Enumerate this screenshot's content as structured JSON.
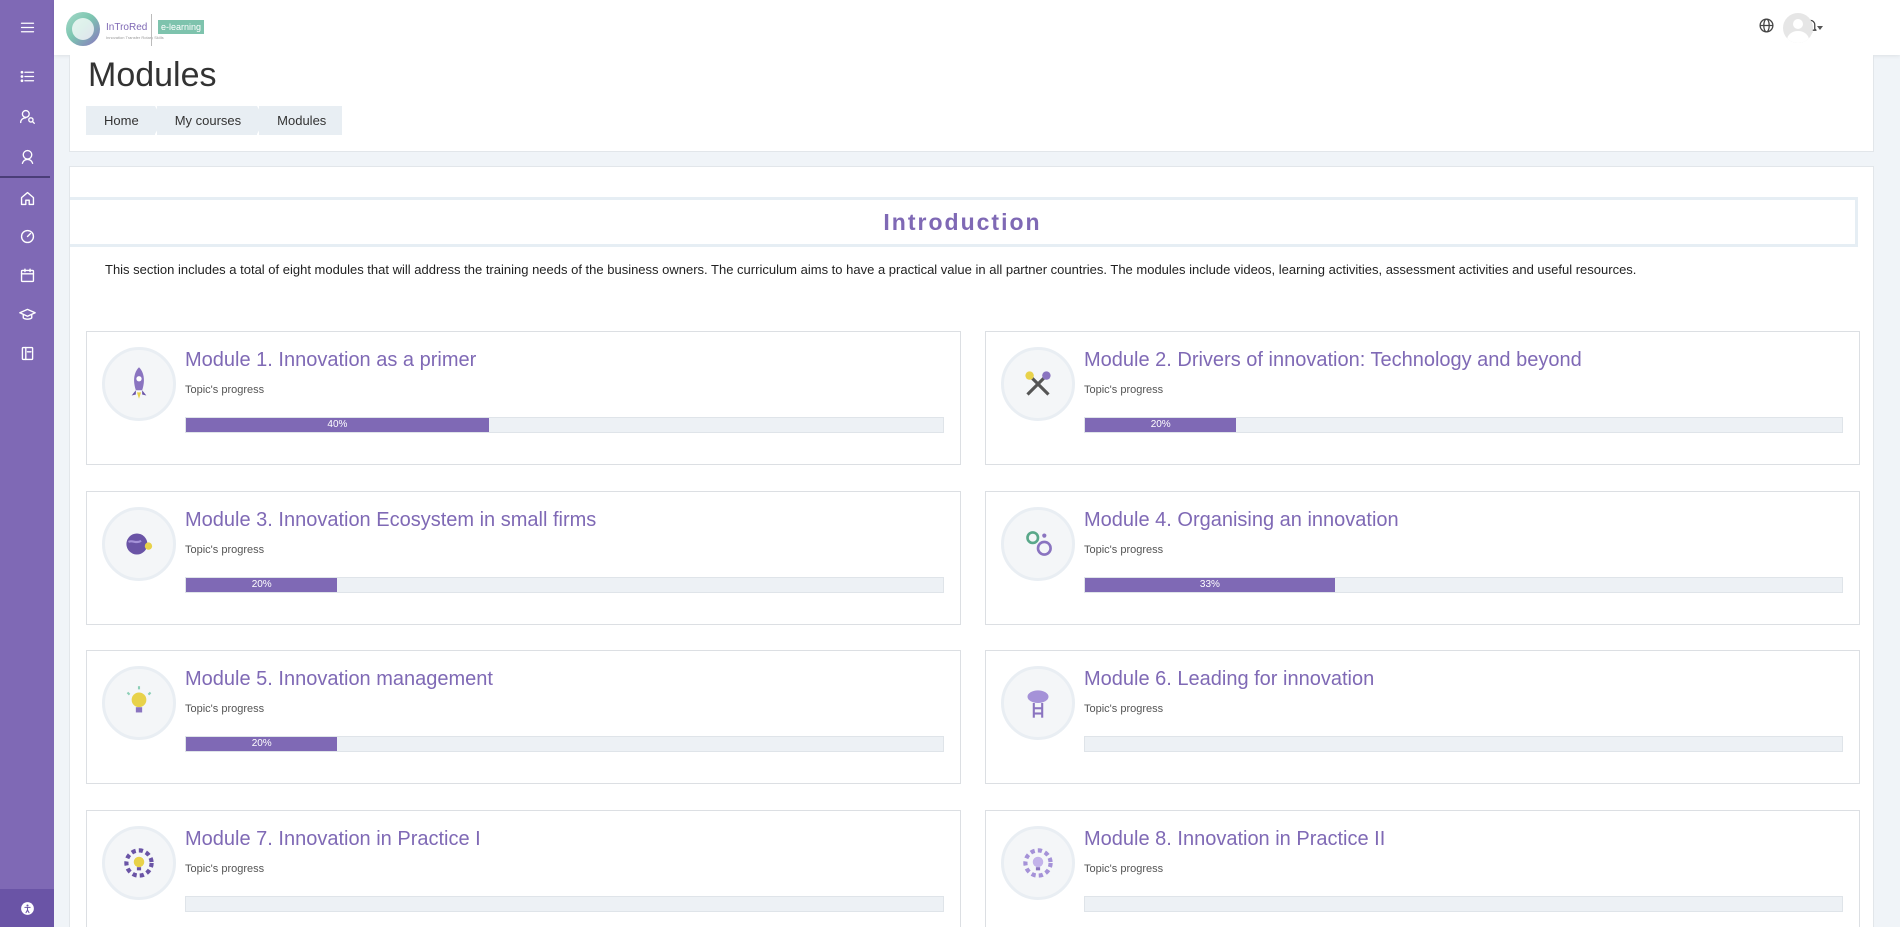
{
  "sidebar": {
    "items": [
      {
        "icon": "menu-icon"
      },
      {
        "icon": "list-icon"
      },
      {
        "icon": "user-search-icon"
      },
      {
        "icon": "user-badge-icon"
      },
      {
        "icon": "home-icon"
      },
      {
        "icon": "dashboard-icon"
      },
      {
        "icon": "calendar-icon"
      },
      {
        "icon": "graduation-cap-icon"
      },
      {
        "icon": "book-icon"
      }
    ],
    "bottom_icon": "accessibility-icon"
  },
  "topbar": {
    "logo_text": "InTroRed",
    "logo_sub": "Innovation Transfer Rotary Skills",
    "logo_badge": "e-learning",
    "icons": [
      "globe-icon",
      "bell-icon",
      "avatar-icon"
    ]
  },
  "header": {
    "title": "Modules",
    "breadcrumb": [
      "Home",
      "My courses",
      "Modules"
    ]
  },
  "intro": {
    "title": "Introduction",
    "text": "This section includes a total of eight modules that will address the training needs of the business owners. The curriculum aims to have a practical value in all partner countries. The modules include videos, learning activities, assessment activities and useful resources."
  },
  "modules": [
    {
      "title": "Module 1. Innovation as a primer",
      "subtitle": "Topic's progress",
      "progress": 40,
      "progress_label": "40%",
      "icon": "rocket-icon"
    },
    {
      "title": "Module 2. Drivers of innovation: Technology and beyond",
      "subtitle": "Topic's progress",
      "progress": 20,
      "progress_label": "20%",
      "icon": "tools-icon"
    },
    {
      "title": "Module 3. Innovation Ecosystem in small firms",
      "subtitle": "Topic's progress",
      "progress": 20,
      "progress_label": "20%",
      "icon": "globe-leaf-icon"
    },
    {
      "title": "Module 4. Organising an innovation",
      "subtitle": "Topic's progress",
      "progress": 33,
      "progress_label": "33%",
      "icon": "gears-icon"
    },
    {
      "title": "Module 5. Innovation management",
      "subtitle": "Topic's progress",
      "progress": 20,
      "progress_label": "20%",
      "icon": "lightbulb-icon"
    },
    {
      "title": "Module 6. Leading for innovation",
      "subtitle": "Topic's progress",
      "progress": 0,
      "progress_label": "",
      "icon": "cloud-ladder-icon"
    },
    {
      "title": "Module 7. Innovation in Practice I",
      "subtitle": "Topic's progress",
      "progress": 0,
      "progress_label": "",
      "icon": "gear-bulb-icon"
    },
    {
      "title": "Module 8. Innovation in Practice II",
      "subtitle": "Topic's progress",
      "progress": 0,
      "progress_label": "",
      "icon": "gear-bulb-purple-icon"
    }
  ],
  "colors": {
    "sidebar": "#7f69b5",
    "accent": "#7f69b5",
    "progress_track": "#edf1f5"
  }
}
